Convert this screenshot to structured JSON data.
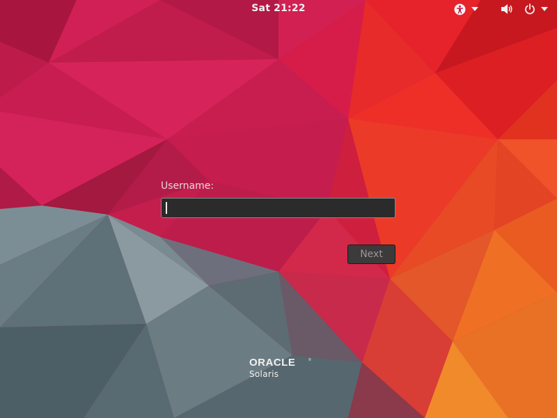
{
  "topbar": {
    "clock": "Sat 21:22",
    "accessibility_icon": "accessibility-icon",
    "volume_icon": "volume-icon",
    "power_icon": "power-icon"
  },
  "login": {
    "username_label": "Username:",
    "username_value": "",
    "next_label": "Next"
  },
  "branding": {
    "logo_text": "ORACLE",
    "product_name": "Solaris"
  },
  "colors": {
    "accent_red": "#c41e4d",
    "accent_orange": "#e8481f",
    "slate": "#6b7f87",
    "input_bg": "#2b2b2b",
    "button_bg": "#3c3a3b"
  }
}
